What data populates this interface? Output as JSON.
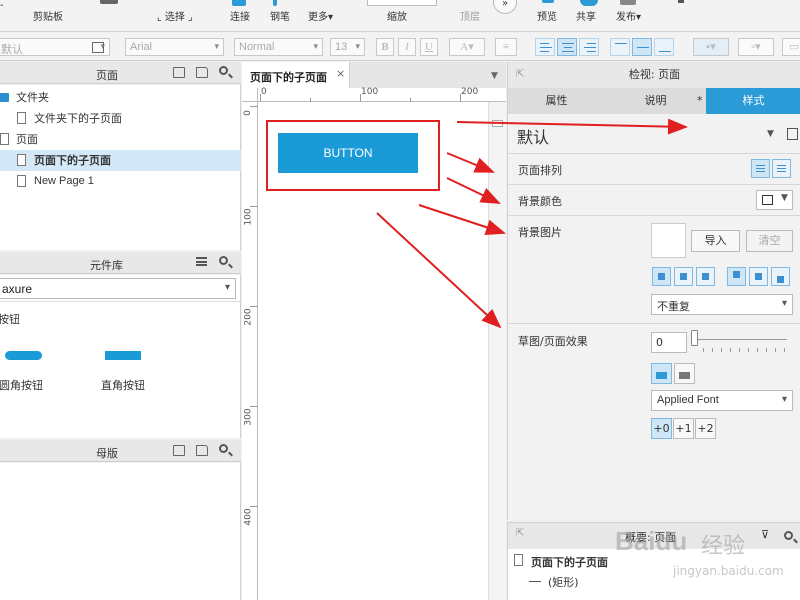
{
  "toolbar": {
    "clipboard": "剪贴板",
    "select": "选择",
    "connect": "连接",
    "pen": "钢笔",
    "more": "更多",
    "zoom": "缩放",
    "top": "顶层",
    "preview": "预览",
    "share": "共享",
    "publish": "发布"
  },
  "format": {
    "style_value": "默认",
    "font": "Arial",
    "weight": "Normal",
    "size": "13",
    "bold": "B",
    "italic": "I",
    "underline": "U"
  },
  "pages_panel": {
    "title": "页面",
    "items": [
      {
        "label": "文件夹",
        "type": "folder"
      },
      {
        "label": "文件夹下的子页面",
        "type": "page"
      },
      {
        "label": "页面",
        "type": "page"
      },
      {
        "label": "页面下的子页面",
        "type": "page",
        "selected": true
      },
      {
        "label": "New Page 1",
        "type": "page"
      }
    ]
  },
  "library_panel": {
    "title": "元件库",
    "library_select": "axure",
    "section": "按钮",
    "widgets": [
      {
        "label": "圆角按钮"
      },
      {
        "label": "直角按钮"
      }
    ]
  },
  "masters_panel": {
    "title": "母版"
  },
  "canvas": {
    "tab_label": "页面下的子页面",
    "tab_close": "×",
    "ruler_h_labels": [
      "0",
      "100",
      "200"
    ],
    "ruler_v_labels": [
      "0",
      "100",
      "200",
      "300",
      "400"
    ],
    "button_text": "BUTTON",
    "accent": "#1a9ad6",
    "annotation_color": "#e02020"
  },
  "inspector": {
    "title": "检视: 页面",
    "tabs": [
      "属性",
      "说明",
      "样式"
    ],
    "tab_marker": "*",
    "active_tab": "样式",
    "style_name": "默认",
    "page_align_label": "页面排列",
    "bg_color_label": "背景颜色",
    "bg_image_label": "背景图片",
    "import_label": "导入",
    "clear_label": "清空",
    "repeat_value": "不重复",
    "sketch_label": "草图/页面效果",
    "sketch_value": "0",
    "font_value": "Applied Font",
    "line_weights": [
      "+0",
      "+1",
      "+2"
    ]
  },
  "summary_panel": {
    "title": "概要: 页面",
    "page": "页面下的子页面",
    "item": "(矩形)"
  },
  "watermark": {
    "brand": "Baidu",
    "brand_cn": "经验",
    "url": "jingyan.baidu.com"
  }
}
